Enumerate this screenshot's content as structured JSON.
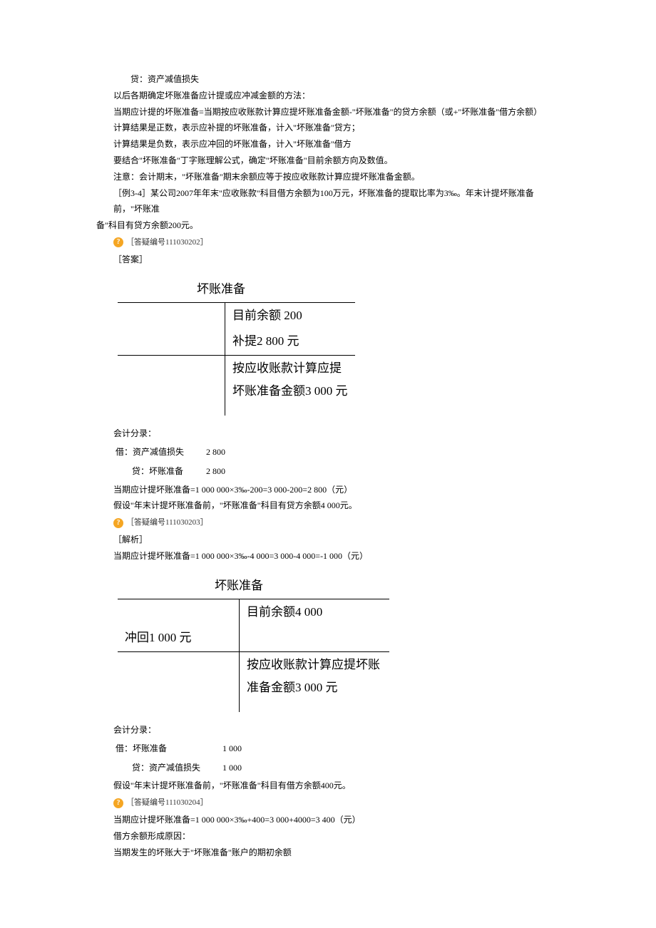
{
  "lines": {
    "l0": "贷：资产减值损失",
    "l1": "以后各期确定坏账准备应计提或应冲减金额的方法：",
    "l2": "当期应计提的坏账准备=当期按应收账款计算应提坏账准备金额-\"坏账准备\"的贷方余额（或+\"坏账准备\"借方余额）",
    "l3": "计算结果是正数，表示应补提的坏账准备，计入\"坏账准备\"贷方；",
    "l4": "计算结果是负数，表示应冲回的坏账准备，计入\"坏账准备\"借方",
    "l5": "要结合\"坏账准备\"丁字账理解公式，确定\"坏账准备\"目前余额方向及数值。",
    "l6": "注意：会计期末，\"坏账准备\"期末余额应等于按应收账款计算应提坏账准备金额。",
    "l7a": "［例3-4］某公司2007年年末\"应收账款\"科目借方余额为100万元，坏账准备的提取比率为3‰。年末计提坏账准备前，\"坏账准",
    "l7b": "备\"科目有贷方余额200元。",
    "note1": "［答疑编号111030202］",
    "ans": "［答案］",
    "tacct1": {
      "title": "坏账准备",
      "r1_left": "",
      "r1_right": "目前余额 200",
      "r2_left": "",
      "r2_right": "补提2 800 元",
      "r3_left": "",
      "r3_right_a": "按应收账款计算应提",
      "r3_right_b": "坏账准备金额3 000 元"
    },
    "sec1": {
      "h": "会计分录：",
      "dr_label": "借：资产减值损失",
      "dr_amt": "2 800",
      "cr_label": "贷：坏账准备",
      "cr_amt": "2 800",
      "calc": "当期应计提坏账准备=1 000 000×3‰-200=3 000-200=2 800（元）",
      "assume": "假设\"年末计提坏账准备前，\"坏账准备\"科目有贷方余额4 000元。"
    },
    "note2": "［答疑编号111030203］",
    "anal": "［解析］",
    "calc2": "当期应计提坏账准备=1 000 000×3‰-4 000=3 000-4 000=-1 000（元）",
    "tacct2": {
      "title": "坏账准备",
      "r1_left": "",
      "r1_right": "目前余额4 000",
      "r2_left": "冲回1 000 元",
      "r2_right": "",
      "r3_left": "",
      "r3_right_a": "按应收账款计算应提坏账",
      "r3_right_b": "准备金额3 000 元"
    },
    "sec2": {
      "h": "会计分录：",
      "dr_label": "借：坏账准备",
      "dr_amt": "1 000",
      "cr_label": "贷：资产减值损失",
      "cr_amt": "1 000",
      "assume": "假设\"年末计提坏账准备前，\"坏账准备\"科目有借方余额400元。"
    },
    "note3": "［答疑编号111030204］",
    "calc3": "当期应计提坏账准备=1 000 000×3‰+400=3 000+4000=3 400（元）",
    "reason_h": "借方余额形成原因：",
    "reason": "当期发生的坏账大于\"坏账准备\"账户的期初余额"
  },
  "icon_glyph": "?"
}
